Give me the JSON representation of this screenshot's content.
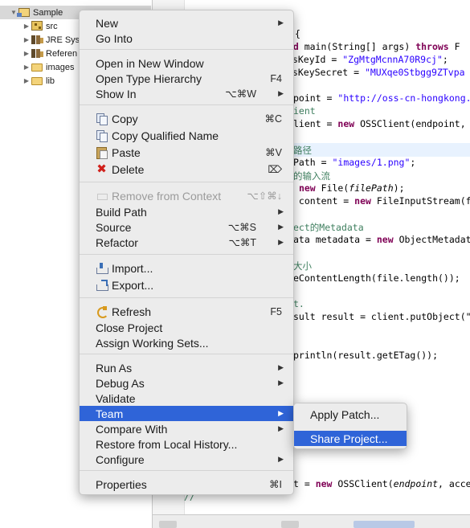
{
  "explorer": {
    "items": [
      {
        "label": "Sample",
        "twisty": "▼",
        "icon": "project-icon",
        "selected": true
      },
      {
        "label": "src",
        "twisty": "▶",
        "icon": "package-folder-icon"
      },
      {
        "label": "JRE Sys",
        "twisty": "▶",
        "icon": "library-icon"
      },
      {
        "label": "Referen",
        "twisty": "▶",
        "icon": "library-icon"
      },
      {
        "label": "images",
        "twisty": "▶",
        "icon": "folder-icon"
      },
      {
        "label": "lib",
        "twisty": "▶",
        "icon": "folder-icon"
      }
    ]
  },
  "editor": {
    "lines": [
      {
        "text": "{"
      },
      {
        "text": "oid main(String[] args) throws F"
      },
      {
        "text": "ssKeyId = \"ZgMtgMcnnA70R9cj\";"
      },
      {
        "text": "ssKeySecret = \"MUXqe0Stbgg9ZTvpa"
      },
      {
        "text": "point = \"http://oss-cn-hongkong.a"
      },
      {
        "text": "ient"
      },
      {
        "text": "lient = new OSSClient(endpoint, "
      },
      {
        "text": "路径"
      },
      {
        "text": "Path = \"images/1.png\";"
      },
      {
        "text": "的输入流"
      },
      {
        "text": " new File(filePath);"
      },
      {
        "text": " content = new FileInputStream(f"
      },
      {
        "text": "ect的Metadata"
      },
      {
        "text": "ata metadata = new ObjectMetadat"
      },
      {
        "text": "大小"
      },
      {
        "text": "eContentLength(file.length());"
      },
      {
        "text": "t."
      },
      {
        "text": "sult result = client.putObject(\""
      },
      {
        "text": "println(result.getETag());"
      },
      {
        "text": "t = new OSSClient(endpoint, acce"
      },
      {
        "text": "//"
      }
    ]
  },
  "menu": {
    "items": [
      {
        "label": "New",
        "shortcut": "",
        "submenu": true
      },
      {
        "label": "Go Into",
        "shortcut": "",
        "submenu": false
      },
      {
        "label": "Open in New Window",
        "shortcut": "",
        "submenu": false
      },
      {
        "label": "Open Type Hierarchy",
        "shortcut": "F4",
        "submenu": false
      },
      {
        "label": "Show In",
        "shortcut": "⌥⌘W",
        "submenu": true
      },
      {
        "label": "Copy",
        "shortcut": "⌘C",
        "submenu": false,
        "icon": "copy-icon"
      },
      {
        "label": "Copy Qualified Name",
        "shortcut": "",
        "submenu": false,
        "icon": "copy-qualified-icon"
      },
      {
        "label": "Paste",
        "shortcut": "⌘V",
        "submenu": false,
        "icon": "paste-icon"
      },
      {
        "label": "Delete",
        "shortcut": "⌦",
        "submenu": false,
        "icon": "delete-icon"
      },
      {
        "label": "Remove from Context",
        "shortcut": "⌥⇧⌘↓",
        "submenu": false,
        "disabled": true,
        "icon": "remove-context-icon"
      },
      {
        "label": "Build Path",
        "shortcut": "",
        "submenu": true
      },
      {
        "label": "Source",
        "shortcut": "⌥⌘S",
        "submenu": true
      },
      {
        "label": "Refactor",
        "shortcut": "⌥⌘T",
        "submenu": true
      },
      {
        "label": "Import...",
        "shortcut": "",
        "submenu": false,
        "icon": "import-icon"
      },
      {
        "label": "Export...",
        "shortcut": "",
        "submenu": false,
        "icon": "export-icon"
      },
      {
        "label": "Refresh",
        "shortcut": "F5",
        "submenu": false,
        "icon": "refresh-icon"
      },
      {
        "label": "Close Project",
        "shortcut": "",
        "submenu": false
      },
      {
        "label": "Assign Working Sets...",
        "shortcut": "",
        "submenu": false
      },
      {
        "label": "Run As",
        "shortcut": "",
        "submenu": true
      },
      {
        "label": "Debug As",
        "shortcut": "",
        "submenu": true
      },
      {
        "label": "Validate",
        "shortcut": "",
        "submenu": false
      },
      {
        "label": "Team",
        "shortcut": "",
        "submenu": true,
        "active": true
      },
      {
        "label": "Compare With",
        "shortcut": "",
        "submenu": true
      },
      {
        "label": "Restore from Local History...",
        "shortcut": "",
        "submenu": false
      },
      {
        "label": "Configure",
        "shortcut": "",
        "submenu": true
      },
      {
        "label": "Properties",
        "shortcut": "⌘I",
        "submenu": false
      }
    ],
    "submenu_arrow": "▶"
  },
  "team_submenu": {
    "items": [
      {
        "label": "Apply Patch..."
      },
      {
        "label": "Share Project...",
        "active": true
      }
    ]
  },
  "colors": {
    "menu_bg": "#ececec",
    "selection": "#2f64d8",
    "keyword": "#7f0055",
    "string": "#2a00ff",
    "comment": "#3f7f5f"
  }
}
